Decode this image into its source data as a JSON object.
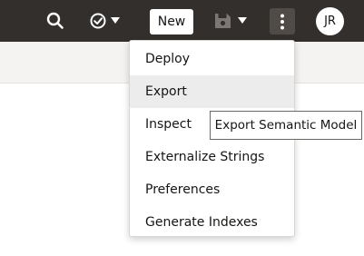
{
  "toolbar": {
    "new_label": "New",
    "avatar_initials": "JR",
    "icons": [
      "search-icon",
      "check-circle-icon",
      "caret-down-icon",
      "save-icon",
      "more-vertical-icon"
    ]
  },
  "menu": {
    "items": [
      {
        "label": "Deploy"
      },
      {
        "label": "Export"
      },
      {
        "label": "Inspect"
      },
      {
        "label": "Externalize Strings"
      },
      {
        "label": "Preferences"
      },
      {
        "label": "Generate Indexes"
      }
    ],
    "highlighted": "Export"
  },
  "tooltip": {
    "text": "Export Semantic Model"
  },
  "colors": {
    "topbar": "#332f2c",
    "subbar": "#f5f3f1",
    "menu_hover": "#ececec"
  }
}
